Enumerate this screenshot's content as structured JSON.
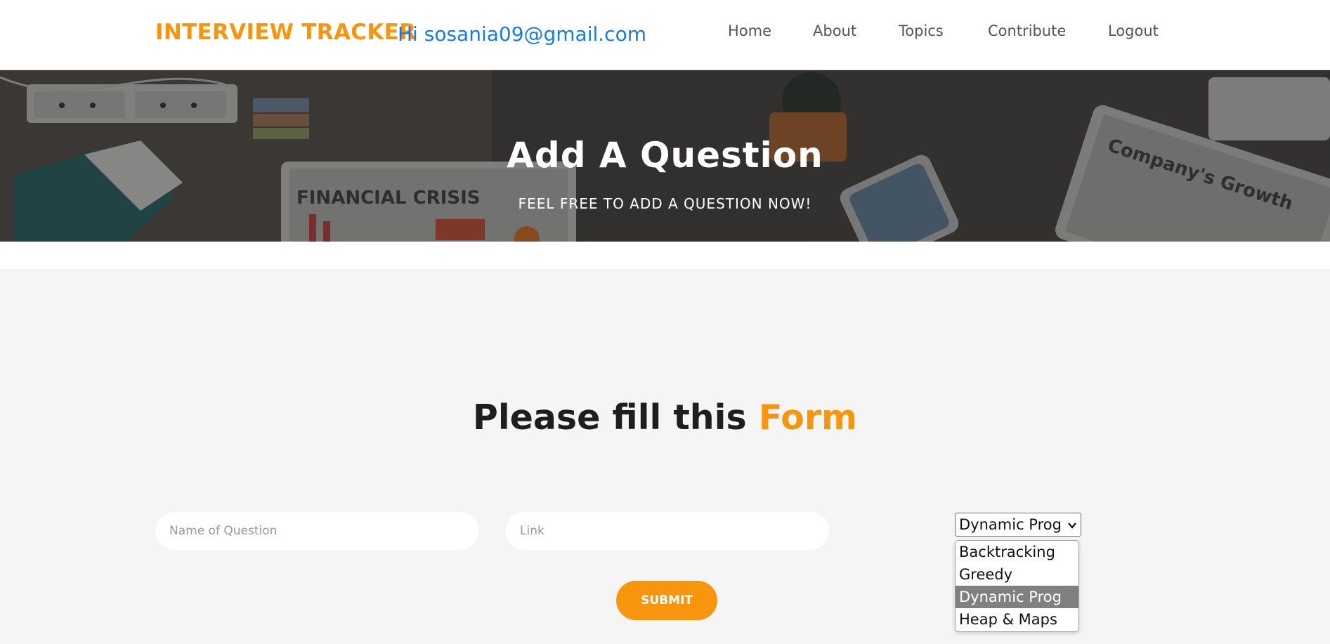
{
  "navbar": {
    "brand": "INTERVIEW TRACKER",
    "greeting": "Hi sosania09@gmail.com",
    "links": [
      "Home",
      "About",
      "Topics",
      "Contribute",
      "Logout"
    ]
  },
  "hero": {
    "title": "Add A Question",
    "subtitle": "FEEL FREE TO ADD A QUESTION NOW!"
  },
  "form": {
    "heading_main": "Please fill this ",
    "heading_accent": "Form",
    "name_placeholder": "Name of Question",
    "link_placeholder": "Link",
    "topic_select": {
      "selected": "Dynamic Prog",
      "options": [
        "Backtracking",
        "Greedy",
        "Dynamic Prog",
        "Heap & Maps"
      ]
    },
    "submit_label": "SUBMIT"
  },
  "colors": {
    "accent": "#f8950f",
    "greeting": "#1a7ae0",
    "form_background": "#f5f5f5",
    "option_highlight": "#808080"
  }
}
